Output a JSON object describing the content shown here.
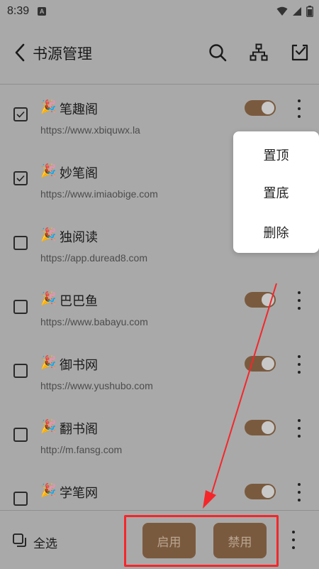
{
  "status": {
    "time": "8:39",
    "notif": "A"
  },
  "header": {
    "title": "书源管理"
  },
  "sources": [
    {
      "name": "笔趣阁",
      "url": "https://www.xbiquwx.la",
      "checked": true,
      "enabled": true
    },
    {
      "name": "妙笔阁",
      "url": "https://www.imiaobige.com",
      "checked": true,
      "enabled": true
    },
    {
      "name": "独阅读",
      "url": "https://app.duread8.com",
      "checked": false,
      "enabled": true
    },
    {
      "name": "巴巴鱼",
      "url": "https://www.babayu.com",
      "checked": false,
      "enabled": true
    },
    {
      "name": "御书网",
      "url": "https://www.yushubo.com",
      "checked": false,
      "enabled": true
    },
    {
      "name": "翻书阁",
      "url": "http://m.fansg.com",
      "checked": false,
      "enabled": true
    },
    {
      "name": "学笔网",
      "url": "",
      "checked": false,
      "enabled": true
    }
  ],
  "emoji": "🎉",
  "popup_menu": {
    "items": [
      "置顶",
      "置底",
      "删除"
    ]
  },
  "bottom": {
    "select_all": "全选",
    "enable": "启用",
    "disable": "禁用"
  },
  "colors": {
    "accent": "#7a5a3e",
    "annotation": "#f5262a"
  }
}
